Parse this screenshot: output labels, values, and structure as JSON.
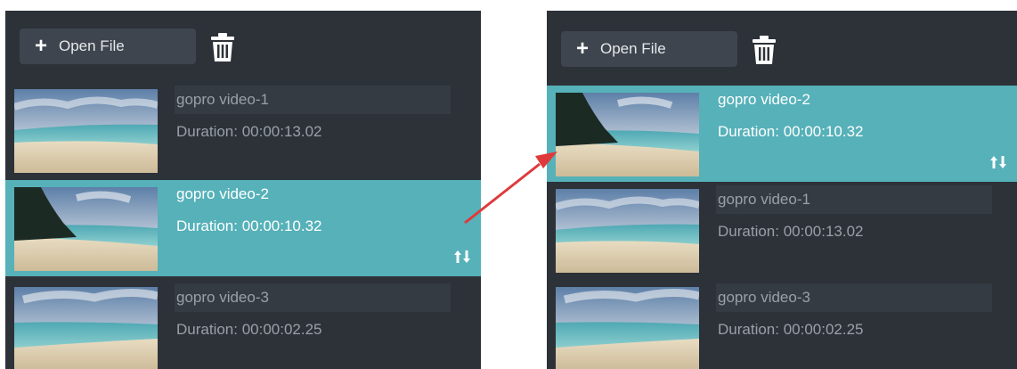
{
  "left_panel": {
    "open_file_label": "Open File",
    "items": [
      {
        "title": "gopro video-1",
        "duration": "Duration: 00:00:13.02",
        "selected": false
      },
      {
        "title": "gopro video-2",
        "duration": "Duration: 00:00:10.32",
        "selected": true
      },
      {
        "title": "gopro video-3",
        "duration": "Duration: 00:00:02.25",
        "selected": false
      }
    ]
  },
  "right_panel": {
    "open_file_label": "Open File",
    "items": [
      {
        "title": "gopro video-2",
        "duration": "Duration: 00:00:10.32",
        "selected": true
      },
      {
        "title": "gopro video-1",
        "duration": "Duration: 00:00:13.02",
        "selected": false
      },
      {
        "title": "gopro video-3",
        "duration": "Duration: 00:00:02.25",
        "selected": false
      }
    ]
  },
  "icons": {
    "add": "plus-icon",
    "delete": "trash-icon",
    "reorder": "sort-arrows-icon"
  },
  "colors": {
    "panel_bg": "#2d3239",
    "selected_bg": "#56b1b9",
    "button_bg": "#3e454e",
    "text_dim": "#9aa0a7",
    "arrow": "#e0393b"
  }
}
